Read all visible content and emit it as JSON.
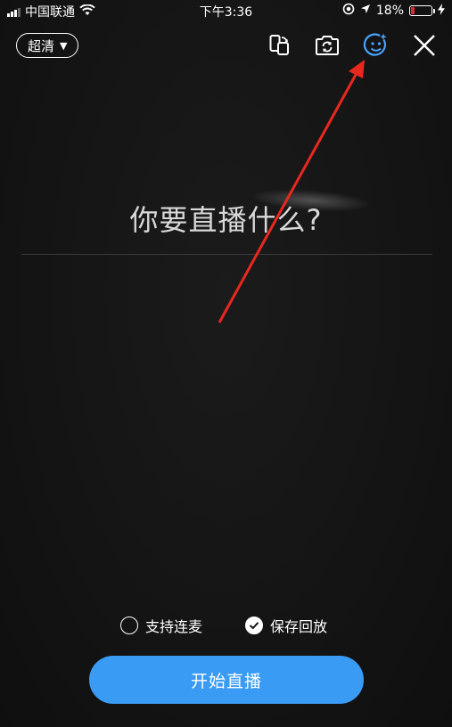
{
  "status_bar": {
    "carrier": "中国联通",
    "time": "下午3:36",
    "battery_percent": "18%",
    "battery_level": 0.18
  },
  "top_bar": {
    "quality_label": "超清",
    "icons": [
      "screen-rotate-icon",
      "camera-flip-icon",
      "beauty-face-icon",
      "close-icon"
    ]
  },
  "main": {
    "title_placeholder": "你要直播什么?"
  },
  "options": {
    "support_mic": {
      "label": "支持连麦",
      "checked": false
    },
    "save_replay": {
      "label": "保存回放",
      "checked": true
    }
  },
  "start_button": {
    "label": "开始直播"
  },
  "colors": {
    "accent": "#3a9bf5",
    "beauty_icon": "#4aa3ff",
    "annotation": "#e8281e",
    "battery_low": "#e02b2b"
  }
}
